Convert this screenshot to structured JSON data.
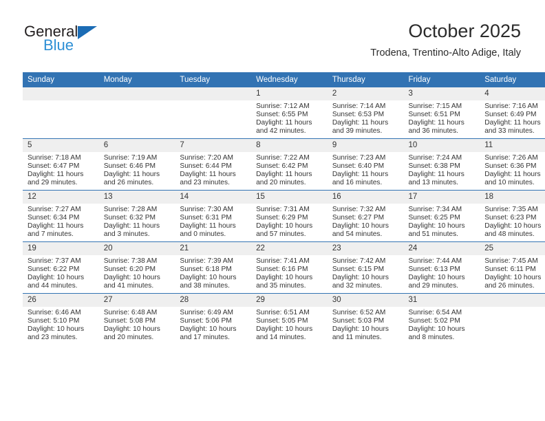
{
  "brand": {
    "word1": "General",
    "word2": "Blue",
    "triangle_color": "#1b6cb5",
    "word1_color": "#231f20",
    "word2_color": "#2d8fd5"
  },
  "header": {
    "title": "October 2025",
    "subtitle": "Trodena, Trentino-Alto Adige, Italy"
  },
  "colors": {
    "header_bar": "#3273b3",
    "daynum_band": "#efefef",
    "text": "#333333"
  },
  "weekday_headers": [
    "Sunday",
    "Monday",
    "Tuesday",
    "Wednesday",
    "Thursday",
    "Friday",
    "Saturday"
  ],
  "labels": {
    "sunrise_prefix": "Sunrise:",
    "sunset_prefix": "Sunset:",
    "daylight_prefix": "Daylight:"
  },
  "weeks": [
    [
      {
        "day": "",
        "line1": "",
        "line2": "",
        "line3": "",
        "line4": ""
      },
      {
        "day": "",
        "line1": "",
        "line2": "",
        "line3": "",
        "line4": ""
      },
      {
        "day": "",
        "line1": "",
        "line2": "",
        "line3": "",
        "line4": ""
      },
      {
        "day": "1",
        "line1": "Sunrise: 7:12 AM",
        "line2": "Sunset: 6:55 PM",
        "line3": "Daylight: 11 hours",
        "line4": "and 42 minutes."
      },
      {
        "day": "2",
        "line1": "Sunrise: 7:14 AM",
        "line2": "Sunset: 6:53 PM",
        "line3": "Daylight: 11 hours",
        "line4": "and 39 minutes."
      },
      {
        "day": "3",
        "line1": "Sunrise: 7:15 AM",
        "line2": "Sunset: 6:51 PM",
        "line3": "Daylight: 11 hours",
        "line4": "and 36 minutes."
      },
      {
        "day": "4",
        "line1": "Sunrise: 7:16 AM",
        "line2": "Sunset: 6:49 PM",
        "line3": "Daylight: 11 hours",
        "line4": "and 33 minutes."
      }
    ],
    [
      {
        "day": "5",
        "line1": "Sunrise: 7:18 AM",
        "line2": "Sunset: 6:47 PM",
        "line3": "Daylight: 11 hours",
        "line4": "and 29 minutes."
      },
      {
        "day": "6",
        "line1": "Sunrise: 7:19 AM",
        "line2": "Sunset: 6:46 PM",
        "line3": "Daylight: 11 hours",
        "line4": "and 26 minutes."
      },
      {
        "day": "7",
        "line1": "Sunrise: 7:20 AM",
        "line2": "Sunset: 6:44 PM",
        "line3": "Daylight: 11 hours",
        "line4": "and 23 minutes."
      },
      {
        "day": "8",
        "line1": "Sunrise: 7:22 AM",
        "line2": "Sunset: 6:42 PM",
        "line3": "Daylight: 11 hours",
        "line4": "and 20 minutes."
      },
      {
        "day": "9",
        "line1": "Sunrise: 7:23 AM",
        "line2": "Sunset: 6:40 PM",
        "line3": "Daylight: 11 hours",
        "line4": "and 16 minutes."
      },
      {
        "day": "10",
        "line1": "Sunrise: 7:24 AM",
        "line2": "Sunset: 6:38 PM",
        "line3": "Daylight: 11 hours",
        "line4": "and 13 minutes."
      },
      {
        "day": "11",
        "line1": "Sunrise: 7:26 AM",
        "line2": "Sunset: 6:36 PM",
        "line3": "Daylight: 11 hours",
        "line4": "and 10 minutes."
      }
    ],
    [
      {
        "day": "12",
        "line1": "Sunrise: 7:27 AM",
        "line2": "Sunset: 6:34 PM",
        "line3": "Daylight: 11 hours",
        "line4": "and 7 minutes."
      },
      {
        "day": "13",
        "line1": "Sunrise: 7:28 AM",
        "line2": "Sunset: 6:32 PM",
        "line3": "Daylight: 11 hours",
        "line4": "and 3 minutes."
      },
      {
        "day": "14",
        "line1": "Sunrise: 7:30 AM",
        "line2": "Sunset: 6:31 PM",
        "line3": "Daylight: 11 hours",
        "line4": "and 0 minutes."
      },
      {
        "day": "15",
        "line1": "Sunrise: 7:31 AM",
        "line2": "Sunset: 6:29 PM",
        "line3": "Daylight: 10 hours",
        "line4": "and 57 minutes."
      },
      {
        "day": "16",
        "line1": "Sunrise: 7:32 AM",
        "line2": "Sunset: 6:27 PM",
        "line3": "Daylight: 10 hours",
        "line4": "and 54 minutes."
      },
      {
        "day": "17",
        "line1": "Sunrise: 7:34 AM",
        "line2": "Sunset: 6:25 PM",
        "line3": "Daylight: 10 hours",
        "line4": "and 51 minutes."
      },
      {
        "day": "18",
        "line1": "Sunrise: 7:35 AM",
        "line2": "Sunset: 6:23 PM",
        "line3": "Daylight: 10 hours",
        "line4": "and 48 minutes."
      }
    ],
    [
      {
        "day": "19",
        "line1": "Sunrise: 7:37 AM",
        "line2": "Sunset: 6:22 PM",
        "line3": "Daylight: 10 hours",
        "line4": "and 44 minutes."
      },
      {
        "day": "20",
        "line1": "Sunrise: 7:38 AM",
        "line2": "Sunset: 6:20 PM",
        "line3": "Daylight: 10 hours",
        "line4": "and 41 minutes."
      },
      {
        "day": "21",
        "line1": "Sunrise: 7:39 AM",
        "line2": "Sunset: 6:18 PM",
        "line3": "Daylight: 10 hours",
        "line4": "and 38 minutes."
      },
      {
        "day": "22",
        "line1": "Sunrise: 7:41 AM",
        "line2": "Sunset: 6:16 PM",
        "line3": "Daylight: 10 hours",
        "line4": "and 35 minutes."
      },
      {
        "day": "23",
        "line1": "Sunrise: 7:42 AM",
        "line2": "Sunset: 6:15 PM",
        "line3": "Daylight: 10 hours",
        "line4": "and 32 minutes."
      },
      {
        "day": "24",
        "line1": "Sunrise: 7:44 AM",
        "line2": "Sunset: 6:13 PM",
        "line3": "Daylight: 10 hours",
        "line4": "and 29 minutes."
      },
      {
        "day": "25",
        "line1": "Sunrise: 7:45 AM",
        "line2": "Sunset: 6:11 PM",
        "line3": "Daylight: 10 hours",
        "line4": "and 26 minutes."
      }
    ],
    [
      {
        "day": "26",
        "line1": "Sunrise: 6:46 AM",
        "line2": "Sunset: 5:10 PM",
        "line3": "Daylight: 10 hours",
        "line4": "and 23 minutes."
      },
      {
        "day": "27",
        "line1": "Sunrise: 6:48 AM",
        "line2": "Sunset: 5:08 PM",
        "line3": "Daylight: 10 hours",
        "line4": "and 20 minutes."
      },
      {
        "day": "28",
        "line1": "Sunrise: 6:49 AM",
        "line2": "Sunset: 5:06 PM",
        "line3": "Daylight: 10 hours",
        "line4": "and 17 minutes."
      },
      {
        "day": "29",
        "line1": "Sunrise: 6:51 AM",
        "line2": "Sunset: 5:05 PM",
        "line3": "Daylight: 10 hours",
        "line4": "and 14 minutes."
      },
      {
        "day": "30",
        "line1": "Sunrise: 6:52 AM",
        "line2": "Sunset: 5:03 PM",
        "line3": "Daylight: 10 hours",
        "line4": "and 11 minutes."
      },
      {
        "day": "31",
        "line1": "Sunrise: 6:54 AM",
        "line2": "Sunset: 5:02 PM",
        "line3": "Daylight: 10 hours",
        "line4": "and 8 minutes."
      },
      {
        "day": "",
        "line1": "",
        "line2": "",
        "line3": "",
        "line4": ""
      }
    ]
  ]
}
